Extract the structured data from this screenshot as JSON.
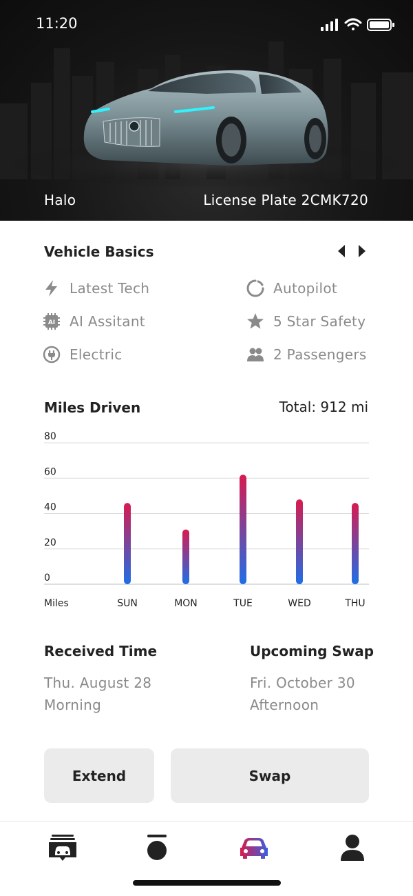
{
  "status": {
    "time": "11:20"
  },
  "vehicle": {
    "name": "Halo",
    "plate": "License Plate 2CMK720"
  },
  "basics": {
    "title": "Vehicle Basics",
    "features_left": [
      {
        "label": "Latest Tech",
        "icon": "lightning-icon"
      },
      {
        "label": "AI Assitant",
        "icon": "chip-icon"
      },
      {
        "label": "Electric",
        "icon": "plug-icon"
      }
    ],
    "features_right": [
      {
        "label": "Autopilot",
        "icon": "autopilot-icon"
      },
      {
        "label": "5 Star Safety",
        "icon": "star-icon"
      },
      {
        "label": "2 Passengers",
        "icon": "passengers-icon"
      }
    ]
  },
  "miles": {
    "title": "Miles Driven",
    "total": "Total: 912 mi"
  },
  "chart_data": {
    "type": "bar",
    "xlabel": "Miles",
    "categories": [
      "SUN",
      "MON",
      "TUE",
      "WED",
      "THU"
    ],
    "values": [
      46,
      31,
      62,
      48,
      46
    ],
    "ylim": [
      0,
      80
    ],
    "yticks": [
      "0",
      "20",
      "40",
      "60",
      "80"
    ],
    "grid": true,
    "colors": {
      "top": "#d81b4f",
      "bottom": "#1e6ee8"
    }
  },
  "received": {
    "title": "Received Time",
    "date": "Thu. August 28",
    "period": "Morning"
  },
  "upcoming": {
    "title": "Upcoming Swap",
    "date": "Fri. October 30",
    "period": "Afternoon"
  },
  "actions": {
    "extend": "Extend",
    "swap": "Swap"
  },
  "tabs": [
    {
      "name": "tab-garage",
      "icon": "garage-icon",
      "active": false
    },
    {
      "name": "tab-key",
      "icon": "key-fob-icon",
      "active": false
    },
    {
      "name": "tab-vehicle",
      "icon": "car-icon",
      "active": true
    },
    {
      "name": "tab-profile",
      "icon": "profile-icon",
      "active": false
    }
  ],
  "colors": {
    "accent_gradient_start": "#d81b4f",
    "accent_gradient_end": "#3a5fe0",
    "muted": "#8a8a8a"
  }
}
